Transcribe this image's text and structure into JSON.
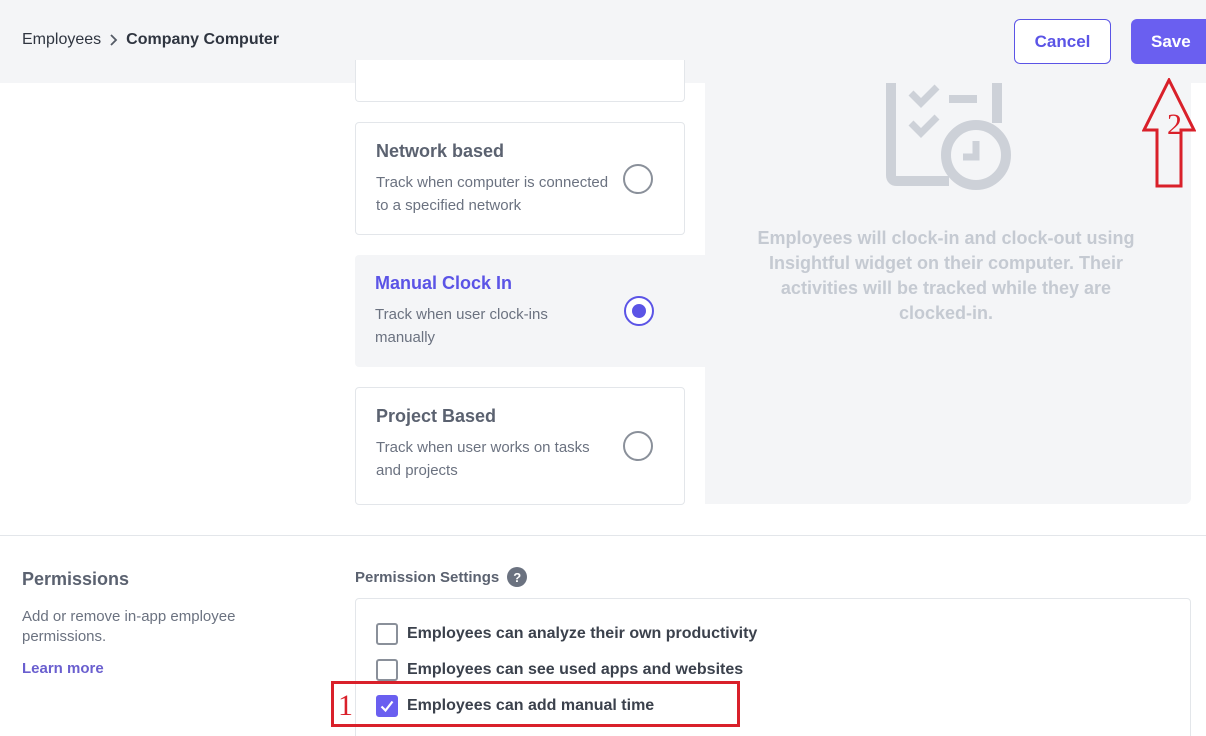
{
  "header": {
    "breadcrumb_root": "Employees",
    "breadcrumb_current": "Company Computer",
    "cancel_label": "Cancel",
    "save_label": "Save"
  },
  "tracking_options": [
    {
      "title": "Network based",
      "description": "Track when computer is connected to a specified network",
      "selected": false
    },
    {
      "title": "Manual Clock In",
      "description": "Track when user clock-ins manually",
      "selected": true
    },
    {
      "title": "Project Based",
      "description": "Track when user works on tasks and projects",
      "selected": false
    }
  ],
  "info_panel": {
    "text": "Employees will clock-in and clock-out using Insightful widget on their computer. Their activities will be tracked while they are clocked-in.",
    "icon": "clipboard-clock-icon"
  },
  "permissions": {
    "title": "Permissions",
    "description": "Add or remove in-app employee permissions.",
    "learn_more": "Learn more",
    "settings_label": "Permission Settings",
    "help_glyph": "?",
    "items": [
      {
        "label": "Employees can analyze their own productivity",
        "checked": false
      },
      {
        "label": "Employees can see used apps and websites",
        "checked": false
      },
      {
        "label": "Employees can add manual time",
        "checked": true
      }
    ]
  },
  "annotations": {
    "step1": "1",
    "step2": "2"
  },
  "colors": {
    "accent": "#6a5ff0",
    "annotation_red": "#d9202a",
    "panel_bg": "#f4f5f7"
  }
}
